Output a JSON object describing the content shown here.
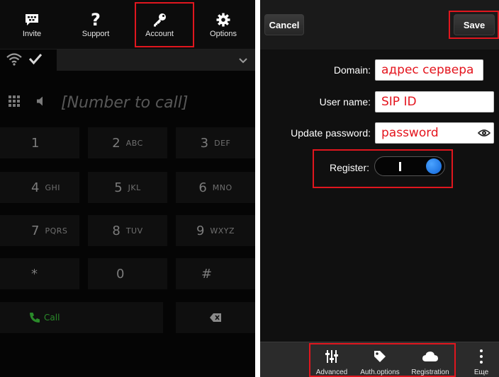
{
  "left_pane": {
    "nav": [
      {
        "label": "Invite",
        "icon": "bbm-chat-icon"
      },
      {
        "label": "Support",
        "icon": "question-mark-icon"
      },
      {
        "label": "Account",
        "icon": "key-icon"
      },
      {
        "label": "Options",
        "icon": "gear-icon"
      }
    ],
    "status_icons": [
      "wifi-icon",
      "checkmark-icon"
    ],
    "dialer": {
      "placeholder": "[Number to call]",
      "keys": [
        {
          "digit": "1",
          "letters": ""
        },
        {
          "digit": "2",
          "letters": "ABC"
        },
        {
          "digit": "3",
          "letters": "DEF"
        },
        {
          "digit": "4",
          "letters": "GHI"
        },
        {
          "digit": "5",
          "letters": "JKL"
        },
        {
          "digit": "6",
          "letters": "MNO"
        },
        {
          "digit": "7",
          "letters": "PQRS"
        },
        {
          "digit": "8",
          "letters": "TUV"
        },
        {
          "digit": "9",
          "letters": "WXYZ"
        },
        {
          "digit": "*",
          "letters": ""
        },
        {
          "digit": "0",
          "letters": ""
        },
        {
          "digit": "#",
          "letters": ""
        }
      ],
      "call_label": "Call"
    }
  },
  "right_pane": {
    "cancel_label": "Cancel",
    "save_label": "Save",
    "form": {
      "domain_label": "Domain:",
      "domain_value": "адрес сервера",
      "username_label": "User name:",
      "username_value": "SIP ID",
      "password_label": "Update password:",
      "password_value": "password",
      "register_label": "Register:",
      "register_on": true
    },
    "bottom_bar": [
      {
        "label": "Advanced",
        "icon": "sliders-icon"
      },
      {
        "label": "Auth.options",
        "icon": "tag-icon"
      },
      {
        "label": "Registration",
        "icon": "cloud-icon"
      },
      {
        "label": "Еще",
        "icon": "more-vertical-icon"
      }
    ]
  },
  "colors": {
    "highlight": "#e0161e",
    "input_text": "#e4141d",
    "toggle_on": "#1b7ae6",
    "call_green": "#2a8a2a"
  }
}
